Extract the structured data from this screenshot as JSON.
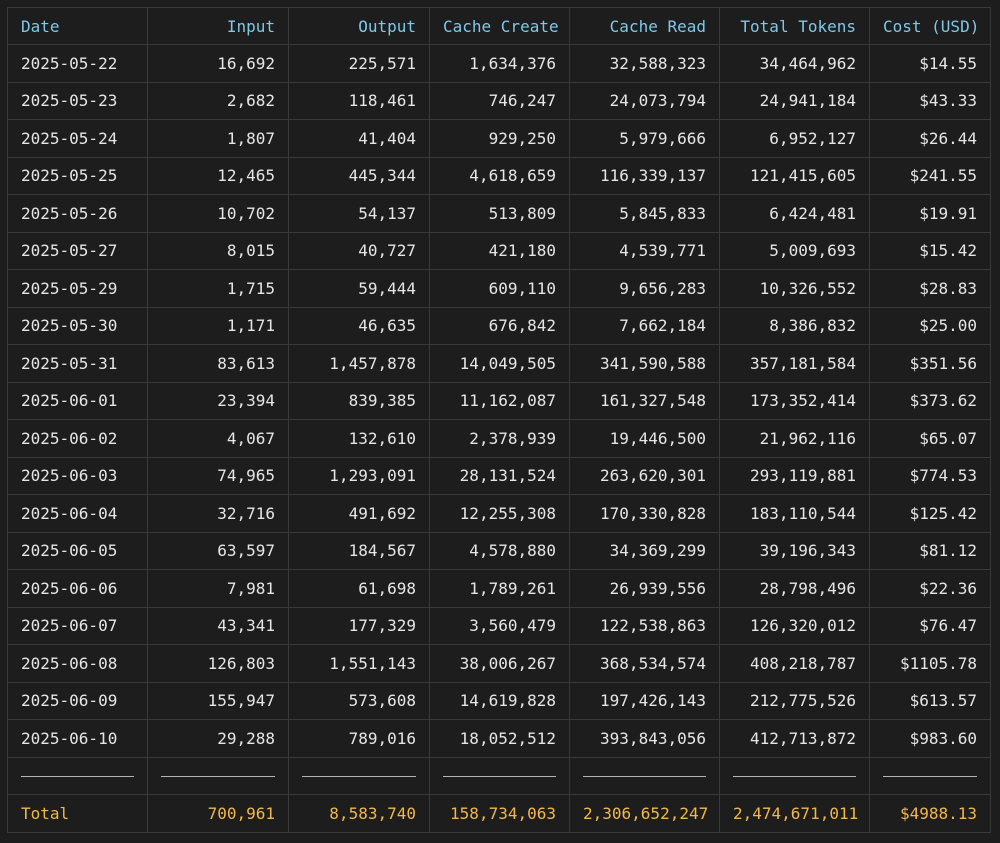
{
  "table": {
    "columns": [
      "Date",
      "Input",
      "Output",
      "Cache Create",
      "Cache Read",
      "Total Tokens",
      "Cost (USD)"
    ],
    "rows": [
      [
        "2025-05-22",
        "16,692",
        "225,571",
        "1,634,376",
        "32,588,323",
        "34,464,962",
        "$14.55"
      ],
      [
        "2025-05-23",
        "2,682",
        "118,461",
        "746,247",
        "24,073,794",
        "24,941,184",
        "$43.33"
      ],
      [
        "2025-05-24",
        "1,807",
        "41,404",
        "929,250",
        "5,979,666",
        "6,952,127",
        "$26.44"
      ],
      [
        "2025-05-25",
        "12,465",
        "445,344",
        "4,618,659",
        "116,339,137",
        "121,415,605",
        "$241.55"
      ],
      [
        "2025-05-26",
        "10,702",
        "54,137",
        "513,809",
        "5,845,833",
        "6,424,481",
        "$19.91"
      ],
      [
        "2025-05-27",
        "8,015",
        "40,727",
        "421,180",
        "4,539,771",
        "5,009,693",
        "$15.42"
      ],
      [
        "2025-05-29",
        "1,715",
        "59,444",
        "609,110",
        "9,656,283",
        "10,326,552",
        "$28.83"
      ],
      [
        "2025-05-30",
        "1,171",
        "46,635",
        "676,842",
        "7,662,184",
        "8,386,832",
        "$25.00"
      ],
      [
        "2025-05-31",
        "83,613",
        "1,457,878",
        "14,049,505",
        "341,590,588",
        "357,181,584",
        "$351.56"
      ],
      [
        "2025-06-01",
        "23,394",
        "839,385",
        "11,162,087",
        "161,327,548",
        "173,352,414",
        "$373.62"
      ],
      [
        "2025-06-02",
        "4,067",
        "132,610",
        "2,378,939",
        "19,446,500",
        "21,962,116",
        "$65.07"
      ],
      [
        "2025-06-03",
        "74,965",
        "1,293,091",
        "28,131,524",
        "263,620,301",
        "293,119,881",
        "$774.53"
      ],
      [
        "2025-06-04",
        "32,716",
        "491,692",
        "12,255,308",
        "170,330,828",
        "183,110,544",
        "$125.42"
      ],
      [
        "2025-06-05",
        "63,597",
        "184,567",
        "4,578,880",
        "34,369,299",
        "39,196,343",
        "$81.12"
      ],
      [
        "2025-06-06",
        "7,981",
        "61,698",
        "1,789,261",
        "26,939,556",
        "28,798,496",
        "$22.36"
      ],
      [
        "2025-06-07",
        "43,341",
        "177,329",
        "3,560,479",
        "122,538,863",
        "126,320,012",
        "$76.47"
      ],
      [
        "2025-06-08",
        "126,803",
        "1,551,143",
        "38,006,267",
        "368,534,574",
        "408,218,787",
        "$1105.78"
      ],
      [
        "2025-06-09",
        "155,947",
        "573,608",
        "14,619,828",
        "197,426,143",
        "212,775,526",
        "$613.57"
      ],
      [
        "2025-06-10",
        "29,288",
        "789,016",
        "18,052,512",
        "393,843,056",
        "412,713,872",
        "$983.60"
      ]
    ],
    "total": [
      "Total",
      "700,961",
      "8,583,740",
      "158,734,063",
      "2,306,652,247",
      "2,474,671,011",
      "$4988.13"
    ]
  },
  "colors": {
    "background": "#1d1d1d",
    "header_text": "#7fc8e8",
    "body_text": "#e6e6e6",
    "total_text": "#f2b84b",
    "grid": "#3a3a3a"
  }
}
